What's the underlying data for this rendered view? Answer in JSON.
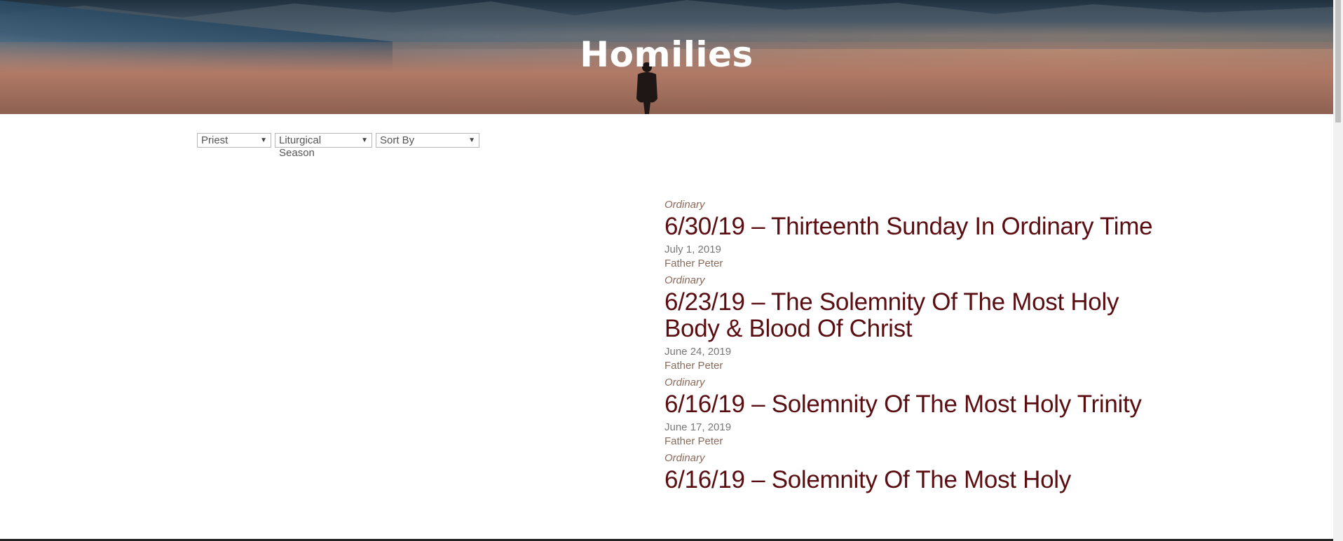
{
  "header": {
    "title": "Homilies"
  },
  "filters": {
    "priest": "Priest",
    "season": "Liturgical Season",
    "sort": "Sort By"
  },
  "homilies": [
    {
      "season": "Ordinary",
      "title": "6/30/19 – Thirteenth Sunday In Ordinary Time",
      "date": "July 1, 2019",
      "priest": "Father Peter"
    },
    {
      "season": "Ordinary",
      "title": "6/23/19 – The Solemnity Of The Most Holy Body & Blood Of Christ",
      "date": "June 24, 2019",
      "priest": "Father Peter"
    },
    {
      "season": "Ordinary",
      "title": "6/16/19 – Solemnity Of The Most Holy Trinity",
      "date": "June 17, 2019",
      "priest": "Father Peter"
    },
    {
      "season": "Ordinary",
      "title": "6/16/19 – Solemnity Of The Most Holy",
      "date": "",
      "priest": ""
    }
  ],
  "colors": {
    "title": "#5a0e12",
    "meta": "#8a6a5a",
    "date": "#777777"
  }
}
